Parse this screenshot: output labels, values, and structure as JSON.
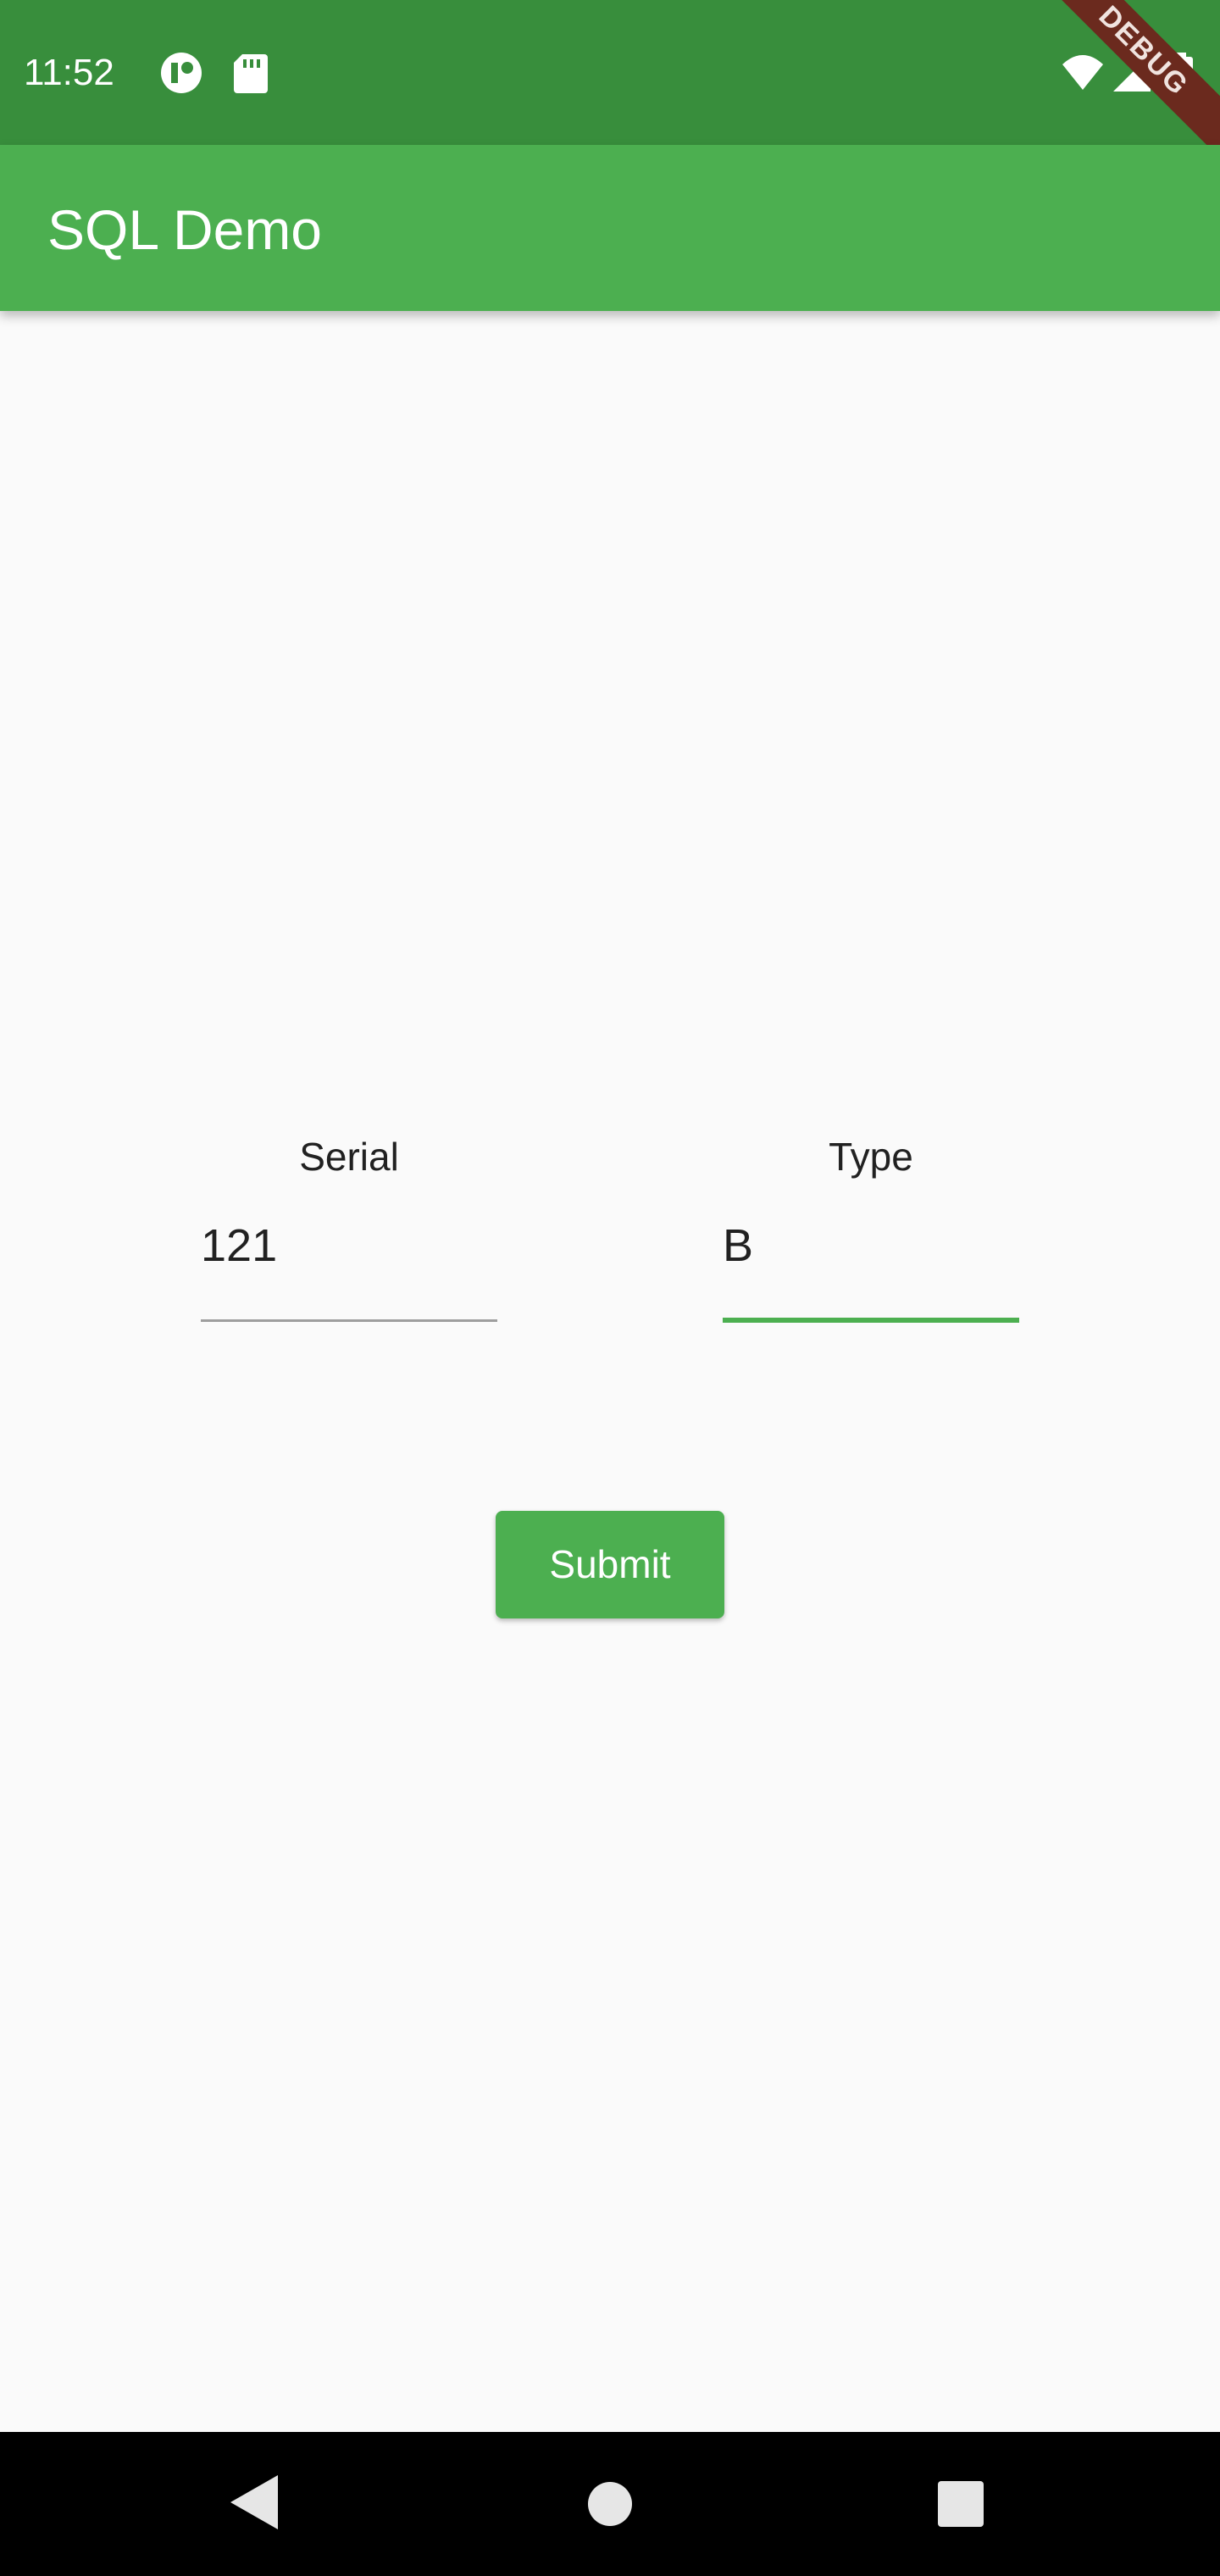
{
  "status_bar": {
    "time": "11:52",
    "left_icons": [
      "privacy-indicator-icon",
      "sd-card-icon"
    ],
    "right_icons": [
      "wifi-icon",
      "cellular-signal-icon",
      "battery-icon"
    ],
    "debug_banner": "DEBUG",
    "colors": {
      "background": "#388e3c"
    }
  },
  "app_bar": {
    "title": "SQL Demo",
    "color": "#4caf50"
  },
  "form": {
    "serial": {
      "label": "Serial",
      "value": "121",
      "focused": false
    },
    "type": {
      "label": "Type",
      "value": "B",
      "focused": true
    },
    "submit_label": "Submit"
  },
  "nav_bar": {
    "buttons": [
      "back-icon",
      "home-icon",
      "recents-icon"
    ]
  },
  "colors": {
    "accent": "#4caf50",
    "background": "#fafafa"
  }
}
